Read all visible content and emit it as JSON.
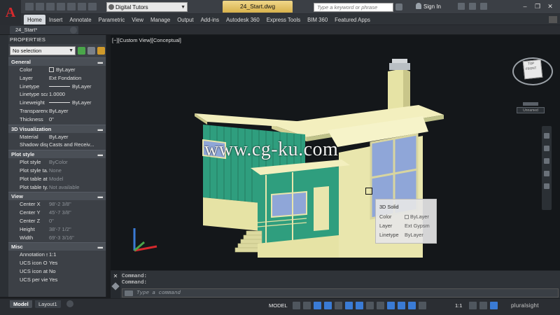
{
  "titlebar": {
    "workspace": "Digital Tutors",
    "document_title": "24_Start.dwg",
    "search_placeholder": "Type a keyword or phrase",
    "signin_label": "Sign In"
  },
  "ribbon": {
    "tabs": [
      "Home",
      "Insert",
      "Annotate",
      "Parametric",
      "View",
      "Manage",
      "Output",
      "Add-ins",
      "Autodesk 360",
      "Express Tools",
      "BIM 360",
      "Featured Apps"
    ]
  },
  "document_tab": {
    "label": "24_Start*"
  },
  "properties": {
    "header": "PROPERTIES",
    "selection": "No selection",
    "sections": {
      "general": {
        "title": "General",
        "rows": [
          {
            "k": "Color",
            "v": "ByLayer"
          },
          {
            "k": "Layer",
            "v": "Ext Fondation"
          },
          {
            "k": "Linetype",
            "v": "ByLayer"
          },
          {
            "k": "Linetype scale",
            "v": "1.0000"
          },
          {
            "k": "Lineweight",
            "v": "ByLayer"
          },
          {
            "k": "Transparency",
            "v": "ByLayer"
          },
          {
            "k": "Thickness",
            "v": "0\""
          }
        ]
      },
      "viz3d": {
        "title": "3D Visualization",
        "rows": [
          {
            "k": "Material",
            "v": "ByLayer"
          },
          {
            "k": "Shadow disp...",
            "v": "Casts and Receiv..."
          }
        ]
      },
      "plot": {
        "title": "Plot style",
        "rows": [
          {
            "k": "Plot style",
            "v": "ByColor"
          },
          {
            "k": "Plot style ta...",
            "v": "None"
          },
          {
            "k": "Plot table att...",
            "v": "Model"
          },
          {
            "k": "Plot table ty...",
            "v": "Not available"
          }
        ]
      },
      "view": {
        "title": "View",
        "rows": [
          {
            "k": "Center X",
            "v": "98'-2 3/8\""
          },
          {
            "k": "Center Y",
            "v": "45'-7 3/8\""
          },
          {
            "k": "Center Z",
            "v": "0\""
          },
          {
            "k": "Height",
            "v": "38'-7 1/2\""
          },
          {
            "k": "Width",
            "v": "69'-3 3/16\""
          }
        ]
      },
      "misc": {
        "title": "Misc",
        "rows": [
          {
            "k": "Annotation s...",
            "v": "1:1"
          },
          {
            "k": "UCS icon On",
            "v": "Yes"
          },
          {
            "k": "UCS icon at...",
            "v": "No"
          },
          {
            "k": "UCS per vie...",
            "v": "Yes"
          }
        ]
      }
    }
  },
  "viewport": {
    "label": "[−][Custom View][Conceptual]",
    "viewcube_face": "FRONT",
    "viewcube_top": "TOP",
    "wcs_label": "Unnamed",
    "watermark": "www.cg-ku.com"
  },
  "tooltip": {
    "title": "3D Solid",
    "rows": [
      {
        "k": "Color",
        "v": "ByLayer"
      },
      {
        "k": "Layer",
        "v": "Ext Gypsm"
      },
      {
        "k": "Linetype",
        "v": "ByLayer"
      }
    ]
  },
  "command": {
    "history": [
      "Command:",
      "Command:"
    ],
    "placeholder": "Type a command"
  },
  "status": {
    "layouts": [
      "Model",
      "Layout1"
    ],
    "model_label": "MODEL",
    "scale": "1:1",
    "brand": "pluralsight"
  },
  "colors": {
    "siding_green": "#2f9e7e",
    "stucco_cream": "#e6e3a5",
    "window_blue": "#8fa6d8",
    "accent_red": "#d6292d"
  }
}
